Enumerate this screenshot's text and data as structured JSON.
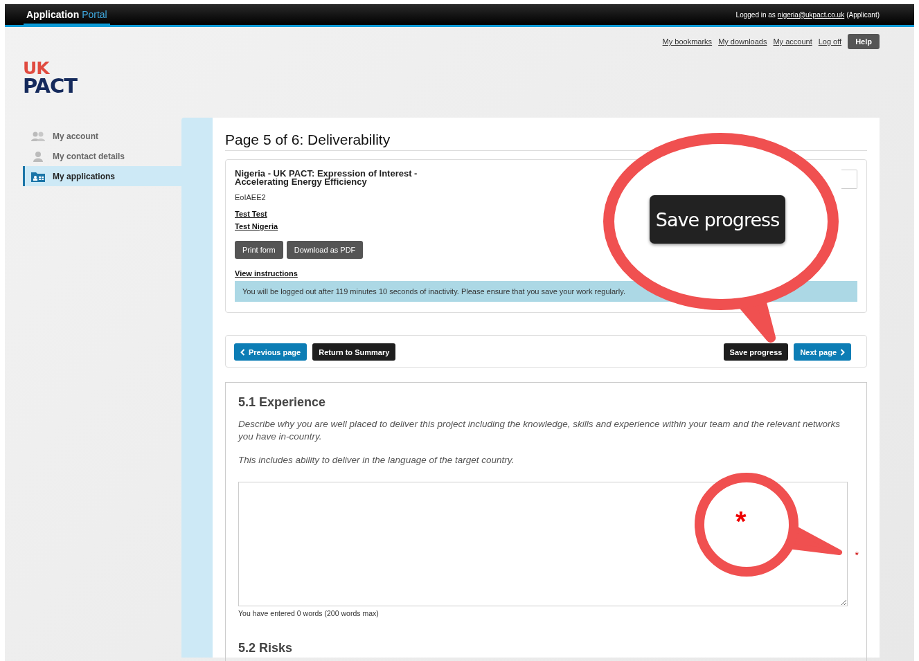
{
  "topbar": {
    "brand": "Application",
    "brand_accent": "Portal",
    "login_prefix": "Logged in as",
    "login_email": "nigeria@ukpact.co.uk",
    "login_suffix": "(Applicant)"
  },
  "header_links": [
    "My bookmarks",
    "My downloads",
    "My account",
    "Log off"
  ],
  "help_button": "Help",
  "logo": {
    "line1": "UK",
    "line2": "PACT"
  },
  "sidebar": {
    "items": [
      {
        "label": "My account",
        "selected": false
      },
      {
        "label": "My contact details",
        "selected": false
      },
      {
        "label": "My applications",
        "selected": true
      }
    ]
  },
  "page_title": "Page 5 of 6: Deliverability",
  "application": {
    "title_line1": "Nigeria - UK PACT: Expression of Interest -",
    "title_line2": "Accelerating Energy Efficiency",
    "code": "EoIAEE2",
    "links": [
      "Test Test",
      "Test Nigeria"
    ],
    "buttons": [
      "Print form",
      "Download as PDF"
    ],
    "instructions_link": "View instructions",
    "timeout_message": "You will be logged out after 119 minutes 10 seconds of inactivity. Please ensure that you save your work regularly."
  },
  "nav_buttons": [
    {
      "label": "Previous page",
      "kind": "previous"
    },
    {
      "label": "Return to Summary",
      "kind": "dark"
    },
    {
      "label": "Save progress",
      "kind": "dark"
    },
    {
      "label": "Next page",
      "kind": "next"
    }
  ],
  "sections": [
    {
      "heading": "5.1 Experience",
      "description": [
        "Describe why you are well placed to deliver this project including the knowledge, skills and experience within your team and the relevant networks you have in-country.",
        "This includes ability to deliver in the language of the target country."
      ],
      "required": true,
      "word_count": "You have entered 0 words (200 words max)"
    },
    {
      "heading": "5.2 Risks"
    }
  ],
  "callouts": [
    {
      "kind": "magnify",
      "text": "Save progress"
    },
    {
      "kind": "marker",
      "text": "*"
    }
  ]
}
